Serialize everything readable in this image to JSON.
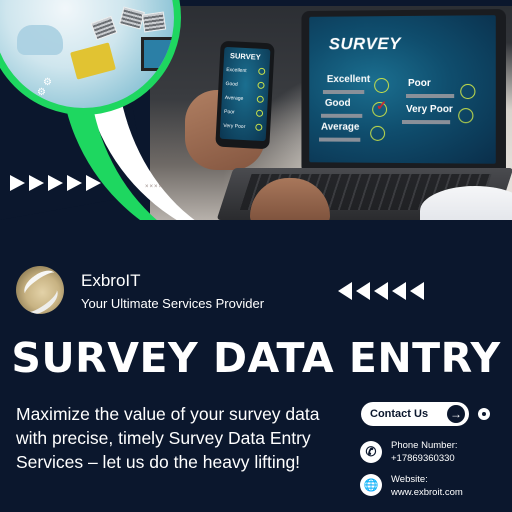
{
  "hero": {
    "laptop_survey": {
      "title": "SURVEY",
      "left_options": [
        "Excellent",
        "Good",
        "Average"
      ],
      "right_options": [
        "Poor",
        "Very Poor"
      ],
      "selected_option": "Good",
      "check_mark": "✓"
    },
    "phone_survey": {
      "title": "SURVEY",
      "options": [
        "Excellent",
        "Good",
        "Average",
        "Poor",
        "Very Poor"
      ]
    },
    "decor_marks": "××××"
  },
  "brand": {
    "name": "ExbroIT",
    "tagline": "Your Ultimate Services Provider",
    "logo_icon": "sphere-logo-icon"
  },
  "headline": "SURVEY DATA ENTRY",
  "description": "Maximize the value of your survey data with precise, timely Survey Data Entry Services – let us do the heavy lifting!",
  "contact": {
    "button_label": "Contact Us",
    "button_icon": "→",
    "phone_label": "Phone Number:",
    "phone_value": "+17869360330",
    "phone_icon": "✆",
    "website_label": "Website:",
    "website_value": "www.exbroit.com",
    "website_icon": "🌐"
  },
  "colors": {
    "background": "#0b172d",
    "accent_green": "#1ed760",
    "checkbox_circle": "#c9e24a",
    "check_red": "#d3232d"
  }
}
